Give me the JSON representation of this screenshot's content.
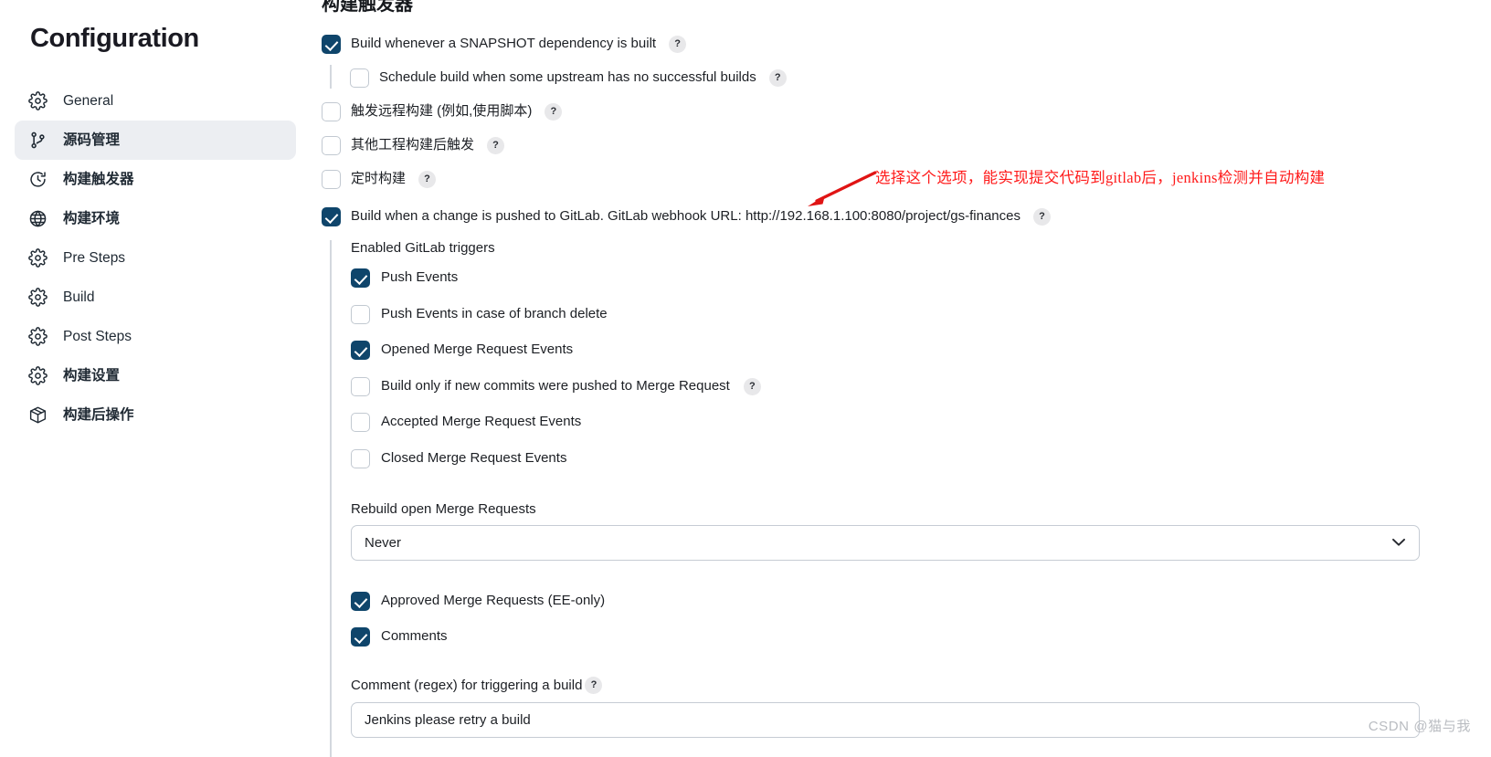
{
  "sidebar": {
    "title": "Configuration",
    "items": [
      {
        "label": "General",
        "icon": "gear-icon",
        "active": false
      },
      {
        "label": "源码管理",
        "icon": "source-branch-icon",
        "active": true
      },
      {
        "label": "构建触发器",
        "icon": "clock-icon",
        "active": false
      },
      {
        "label": "构建环境",
        "icon": "globe-icon",
        "active": false
      },
      {
        "label": "Pre Steps",
        "icon": "gear-icon",
        "active": false
      },
      {
        "label": "Build",
        "icon": "gear-icon",
        "active": false
      },
      {
        "label": "Post Steps",
        "icon": "gear-icon",
        "active": false
      },
      {
        "label": "构建设置",
        "icon": "gear-icon",
        "active": false
      },
      {
        "label": "构建后操作",
        "icon": "package-icon",
        "active": false
      }
    ]
  },
  "main": {
    "section_title": "构建触发器",
    "help_glyph": "?",
    "triggers": [
      {
        "label": "Build whenever a SNAPSHOT dependency is built",
        "checked": true,
        "help": true
      },
      {
        "label": "Schedule build when some upstream has no successful builds",
        "checked": false,
        "help": true
      },
      {
        "label": "触发远程构建 (例如,使用脚本)",
        "checked": false,
        "help": true
      },
      {
        "label": "其他工程构建后触发",
        "checked": false,
        "help": true
      },
      {
        "label": "定时构建",
        "checked": false,
        "help": true
      },
      {
        "label": "Build when a change is pushed to GitLab. GitLab webhook URL: http://192.168.1.100:8080/project/gs-finances",
        "checked": true,
        "help": true
      }
    ],
    "gitlab": {
      "enabled_title": "Enabled GitLab triggers",
      "events": [
        {
          "label": "Push Events",
          "checked": true,
          "help": false
        },
        {
          "label": "Push Events in case of branch delete",
          "checked": false,
          "help": false
        },
        {
          "label": "Opened Merge Request Events",
          "checked": true,
          "help": false
        },
        {
          "label": "Build only if new commits were pushed to Merge Request",
          "checked": false,
          "help": true
        },
        {
          "label": "Accepted Merge Request Events",
          "checked": false,
          "help": false
        },
        {
          "label": "Closed Merge Request Events",
          "checked": false,
          "help": false
        }
      ],
      "rebuild_label": "Rebuild open Merge Requests",
      "rebuild_value": "Never",
      "rebuild_options": [
        "Never"
      ],
      "post_events": [
        {
          "label": "Approved Merge Requests (EE-only)",
          "checked": true,
          "help": false
        },
        {
          "label": "Comments",
          "checked": true,
          "help": false
        }
      ],
      "comment_regex_label": "Comment (regex) for triggering a build",
      "comment_regex_value": "Jenkins please retry a build"
    }
  },
  "annotation": {
    "text": "选择这个选项，能实现提交代码到gitlab后，jenkins检测并自动构建",
    "color": "#ff1a1a"
  },
  "watermark": {
    "text": "CSDN @猫与我"
  },
  "colors": {
    "checkbox_checked": "#0f456b",
    "checkbox_border": "#c2c9d1",
    "sidebar_active_bg": "#eceef2",
    "annotation_red": "#ff1a1a",
    "watermark_gray": "#b9bcc1"
  }
}
